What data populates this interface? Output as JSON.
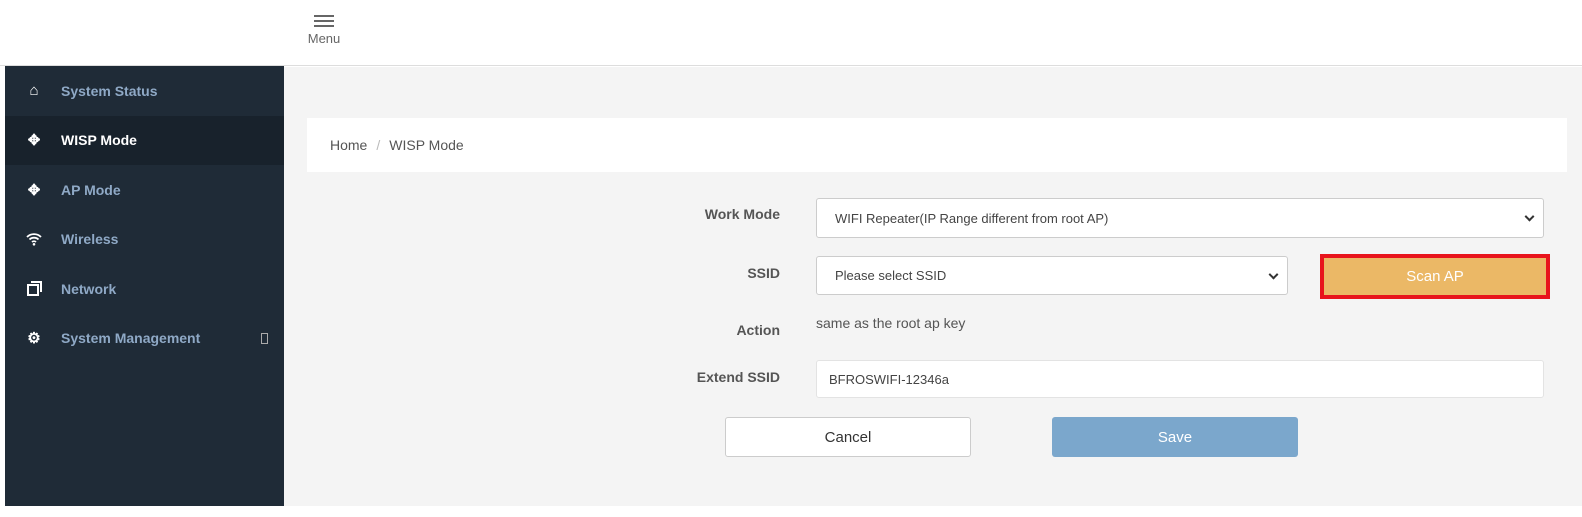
{
  "header": {
    "menu_label": "Menu"
  },
  "sidebar": {
    "items": [
      {
        "label": "System Status",
        "icon": "home-icon"
      },
      {
        "label": "WISP Mode",
        "icon": "move-icon",
        "active": true
      },
      {
        "label": "AP Mode",
        "icon": "move-icon"
      },
      {
        "label": "Wireless",
        "icon": "wifi-icon"
      },
      {
        "label": "Network",
        "icon": "copy-icon"
      },
      {
        "label": "System Management",
        "icon": "gear-icon"
      }
    ]
  },
  "breadcrumb": {
    "home": "Home",
    "separator": "/",
    "current": "WISP Mode"
  },
  "form": {
    "work_mode_label": "Work Mode",
    "work_mode_value": "WIFI Repeater(IP Range different from root AP)",
    "ssid_label": "SSID",
    "ssid_value": "Please select SSID",
    "scan_label": "Scan AP",
    "action_label": "Action",
    "action_value": "same as the root ap key",
    "extend_ssid_label": "Extend SSID",
    "extend_ssid_value": "BFROSWIFI-12346a",
    "cancel_label": "Cancel",
    "save_label": "Save"
  },
  "colors": {
    "sidebar": "#1f2b37",
    "scan": "#ebb866",
    "highlight": "#e8141c",
    "save": "#7ba7cc"
  }
}
